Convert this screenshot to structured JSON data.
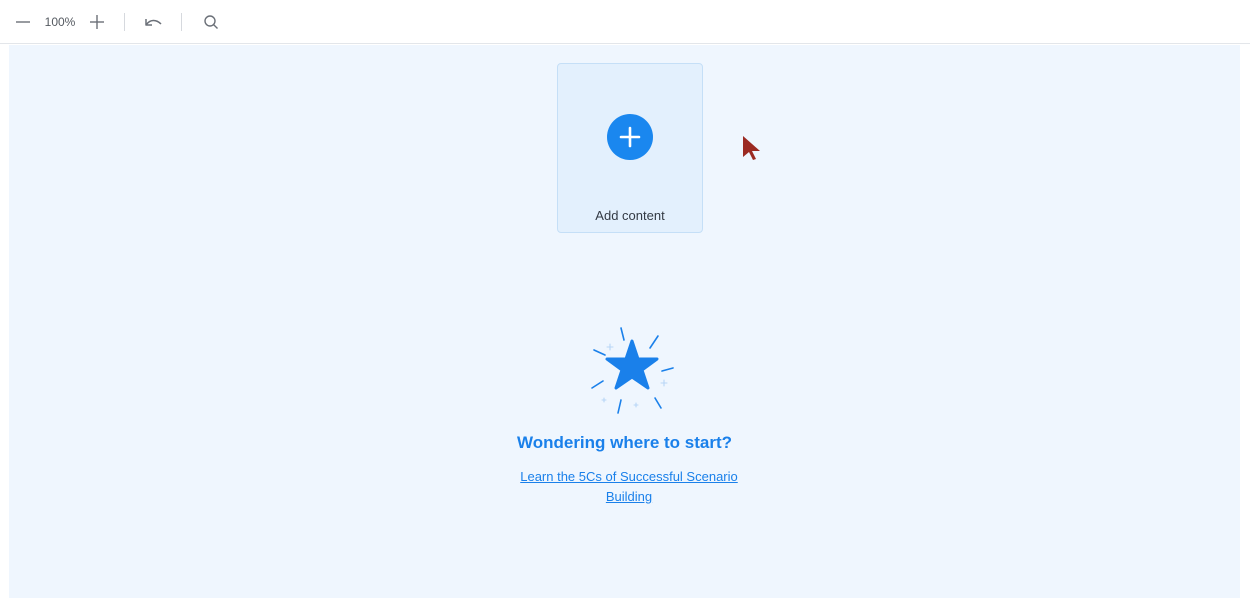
{
  "toolbar": {
    "zoom_level": "100%",
    "icons": [
      "minus-icon",
      "plus-icon",
      "undo-icon",
      "search-icon"
    ]
  },
  "canvas": {
    "add_card": {
      "label": "Add content",
      "icon": "plus-circle-icon"
    },
    "empty_state": {
      "icon": "sparkle-star-icon",
      "headline": "Wondering where to start?",
      "link": "Learn the 5Cs of Successful Scenario Building"
    }
  },
  "colors": {
    "accent": "#1a87ef",
    "canvas_bg": "#eff6fe",
    "card_bg": "#e3f0fd",
    "cursor": "#9b2a22"
  }
}
